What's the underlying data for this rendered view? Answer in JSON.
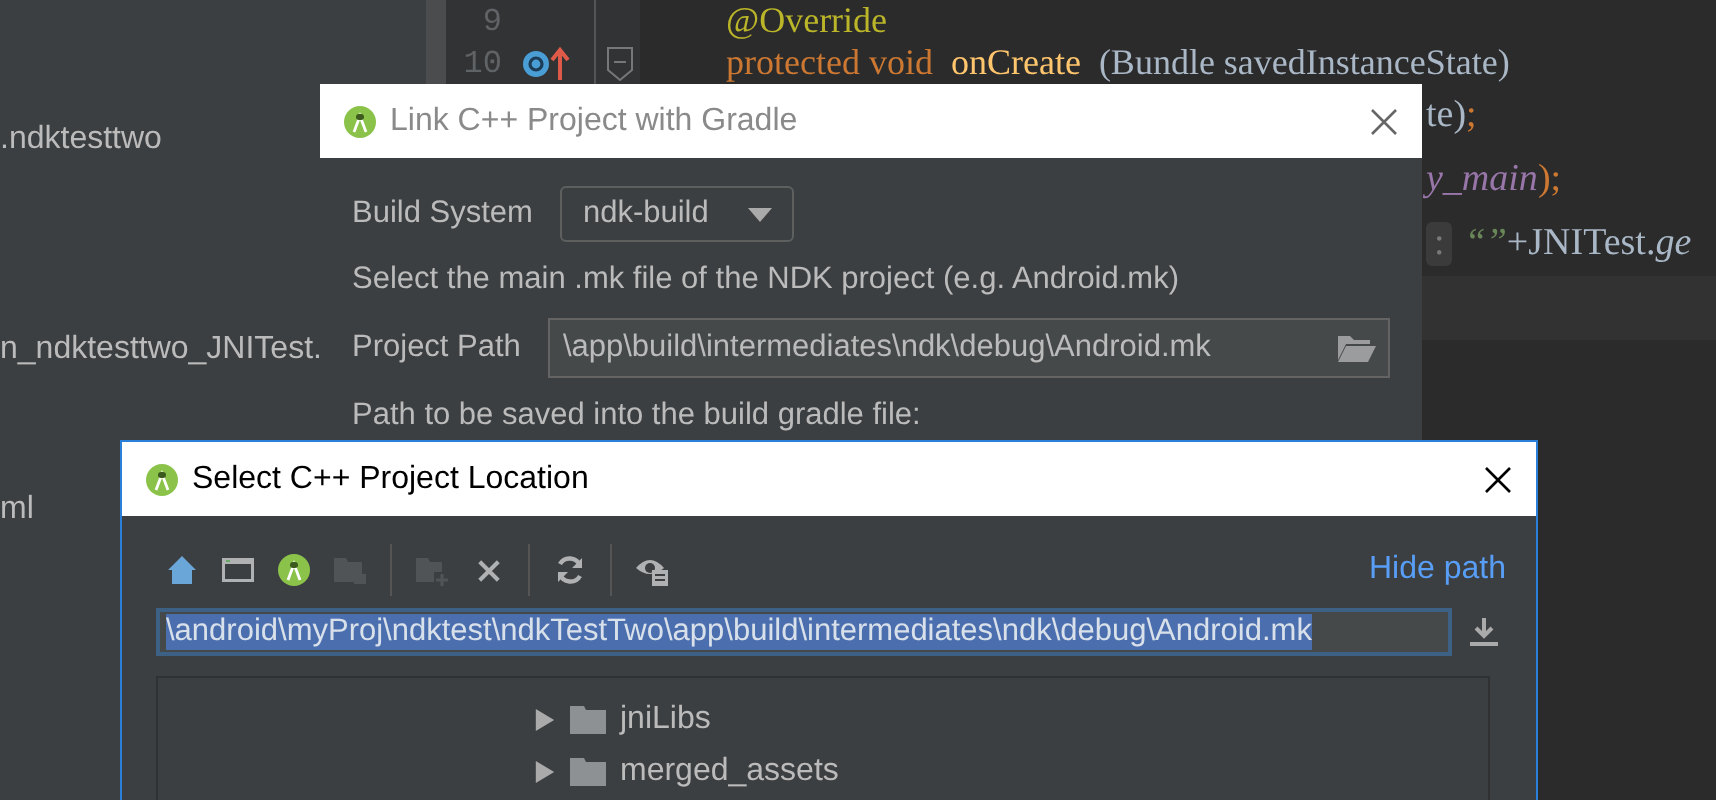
{
  "project_panel": {
    "items": [
      ".ndktesttwo",
      "n_ndktesttwo_JNITest.",
      "ml"
    ]
  },
  "editor": {
    "lines": [
      {
        "number": "9",
        "tokens": [
          {
            "text": "@Override",
            "kind": "annotation"
          }
        ]
      },
      {
        "number": "10",
        "tokens": [
          {
            "text": "protected void",
            "kind": "keyword"
          },
          {
            "text": "onCreate",
            "kind": "method"
          },
          {
            "text": "(Bundle savedInstanceState)",
            "kind": "plain"
          }
        ]
      },
      {
        "tokens": [
          {
            "text": "te)",
            "kind": "plain"
          },
          {
            "text": ";",
            "kind": "keyword"
          }
        ]
      },
      {
        "tokens": [
          {
            "text": "y_main",
            "kind": "field"
          },
          {
            "text": ");",
            "kind": "keyword"
          }
        ]
      },
      {
        "tokens": [
          {
            "text": ":",
            "kind": "hint"
          },
          {
            "text": "“”",
            "kind": "string"
          },
          {
            "text": "+JNITest.",
            "kind": "plain"
          },
          {
            "text": "ge",
            "kind": "static"
          }
        ]
      }
    ]
  },
  "link_dialog": {
    "title": "Link C++ Project with Gradle",
    "build_system_label": "Build System",
    "build_system": "ndk-build",
    "hint": "Select the main .mk file of the NDK project (e.g. Android.mk)",
    "project_path_label": "Project Path",
    "project_path": "\\app\\build\\intermediates\\ndk\\debug\\Android.mk",
    "save_path_label": "Path to be saved into the build gradle file:"
  },
  "select_dialog": {
    "title": "Select C++ Project Location",
    "toolbar": [
      [
        {
          "kind": "home",
          "disabled": false
        },
        {
          "kind": "desktop",
          "disabled": false
        },
        {
          "kind": "android",
          "disabled": false
        },
        {
          "kind": "project",
          "disabled": true
        }
      ],
      [
        {
          "kind": "new-folder",
          "disabled": true
        },
        {
          "kind": "delete",
          "disabled": false
        }
      ],
      [
        {
          "kind": "refresh",
          "disabled": false
        }
      ],
      [
        {
          "kind": "hidden-files",
          "disabled": false
        }
      ]
    ],
    "hide_path": "Hide path",
    "path": "\\android\\myProj\\ndktest\\ndkTestTwo\\app\\build\\intermediates\\ndk\\debug\\Android.mk",
    "path_selected": true,
    "tree": [
      {
        "label": "jniLibs",
        "expanded": false
      },
      {
        "label": "merged_assets",
        "expanded": false
      }
    ]
  }
}
